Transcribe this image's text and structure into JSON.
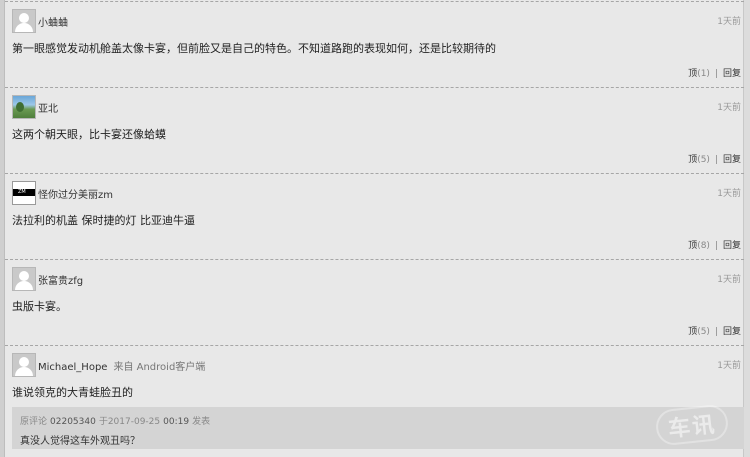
{
  "comments": [
    {
      "username": "小蛐蛐",
      "via": "",
      "time": "1天前",
      "content": "第一眼感觉发动机舱盖太像卡宴，但前脸又是自己的特色。不知道路跑的表现如何，还是比较期待的",
      "upvote_label": "顶",
      "upvote_count": "(1)",
      "reply_label": "回复",
      "avatar": "default-avatar"
    },
    {
      "username": "亚北",
      "via": "",
      "time": "1天前",
      "content": "这两个朝天眼，比卡宴还像蛤蟆",
      "upvote_label": "顶",
      "upvote_count": "(5)",
      "reply_label": "回复",
      "avatar": "photo-avatar"
    },
    {
      "username": "怪你过分美丽zm",
      "via": "",
      "time": "1天前",
      "content": "法拉利的机盖 保时捷的灯 比亚迪牛逼",
      "upvote_label": "顶",
      "upvote_count": "(8)",
      "reply_label": "回复",
      "avatar": "black-avatar",
      "avatar_text": "ZM"
    },
    {
      "username": "张富贵zfg",
      "via": "",
      "time": "1天前",
      "content": "虫版卡宴。",
      "upvote_label": "顶",
      "upvote_count": "(5)",
      "reply_label": "回复",
      "avatar": "default-avatar"
    },
    {
      "username": "Michael_Hope",
      "via": "来自 Android客户端",
      "time": "1天前",
      "content": "谁说领克的大青蛙脸丑的",
      "avatar": "default-avatar",
      "quote": {
        "prefix": "原评论",
        "user": "02205340",
        "mid": "于2017-09-25",
        "time": "00:19",
        "suffix": "发表",
        "text": "真没人觉得这车外观丑吗？"
      }
    }
  ],
  "watermark": "车讯",
  "colors": {
    "background": "#e8e8e8",
    "quote_background": "#d4d4d4",
    "divider": "#a6a6a6"
  }
}
